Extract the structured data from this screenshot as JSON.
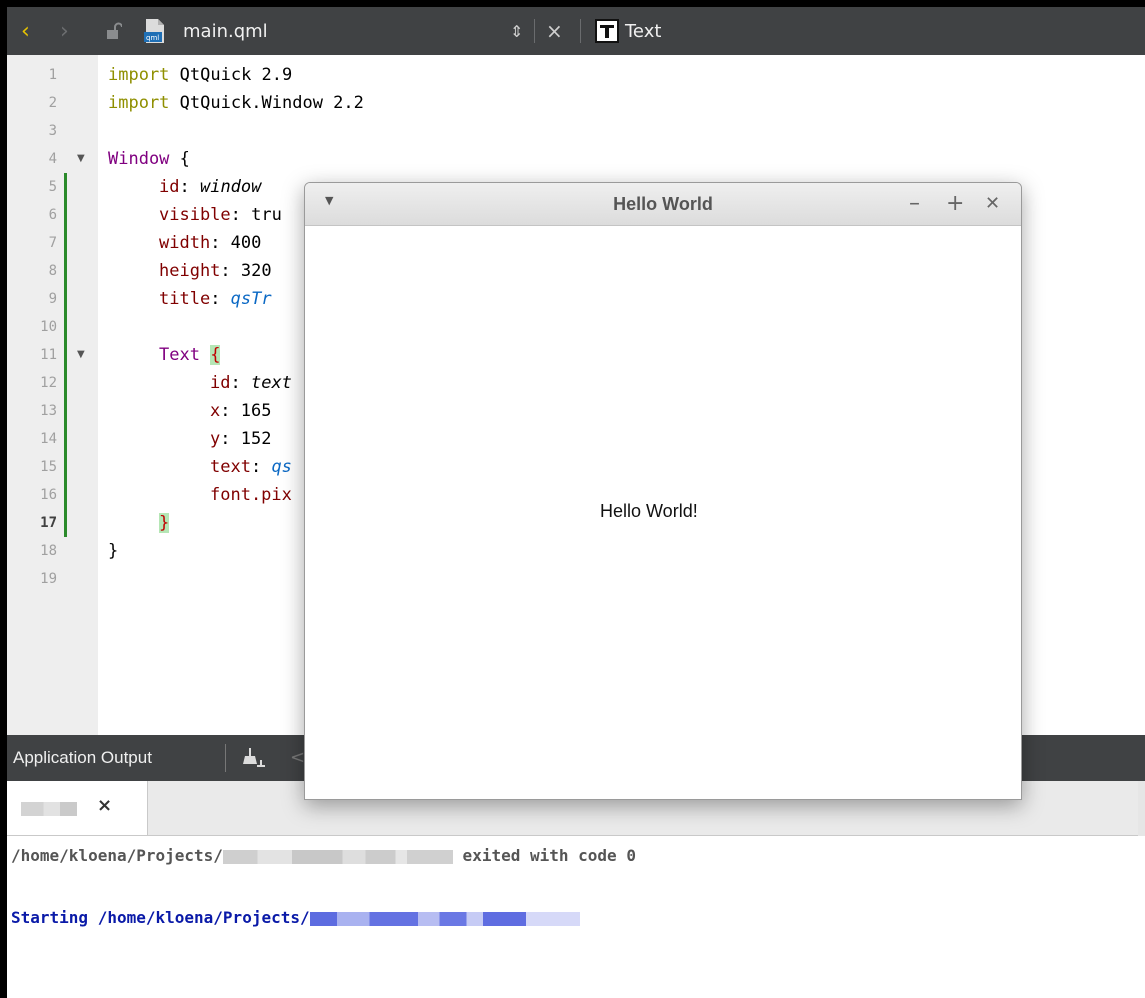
{
  "toolbar": {
    "back_icon": "chevron-left-icon",
    "forward_icon": "chevron-right-icon",
    "lock_icon": "lock-icon",
    "file_icon": "qml-file-icon",
    "filename": "main.qml",
    "updown_glyph": "⇕",
    "close_glyph": "×",
    "symbol_icon": "text-type-icon",
    "symbol_label": "Text"
  },
  "editor": {
    "line_numbers": [
      "1",
      "2",
      "3",
      "4",
      "5",
      "6",
      "7",
      "8",
      "9",
      "10",
      "11",
      "12",
      "13",
      "14",
      "15",
      "16",
      "17",
      "18",
      "19"
    ],
    "current_line": "17",
    "lines": {
      "l1_kw": "import",
      "l1_rest": " QtQuick 2.9",
      "l2_kw": "import",
      "l2_rest": " QtQuick.Window 2.2",
      "l4_type": "Window",
      "l4_brace": " {",
      "l5_prop": "id",
      "l5_colon": ": ",
      "l5_val": "window",
      "l6_prop": "visible",
      "l6_rest": ": tru",
      "l7_prop": "width",
      "l7_rest": ": 400",
      "l8_prop": "height",
      "l8_rest": ": 320",
      "l9_prop": "title",
      "l9_colon": ": ",
      "l9_fn": "qsTr",
      "l11_type": "Text",
      "l11_brace": "{",
      "l12_prop": "id",
      "l12_colon": ": ",
      "l12_val": "text",
      "l13_prop": "x",
      "l13_rest": ": 165",
      "l14_prop": "y",
      "l14_rest": ": 152",
      "l15_prop": "text",
      "l15_colon": ": ",
      "l15_fn": "qs",
      "l16_prop": "font.pix",
      "l17_brace": "}",
      "l18_brace": "}"
    }
  },
  "output_panel": {
    "title": "Application Output",
    "clean_icon": "clean-broom-icon",
    "prev_glyph": "<",
    "tab_close": "×",
    "line1_prefix": "/home/kloena/Projects/",
    "line1_suffix": " exited with code 0",
    "line2_prefix": "Starting /home/kloena/Projects/"
  },
  "app_window": {
    "menu_glyph": "▼",
    "title": "Hello World",
    "minimize": "–",
    "maximize": "+",
    "close": "✕",
    "content_text": "Hello World!"
  }
}
